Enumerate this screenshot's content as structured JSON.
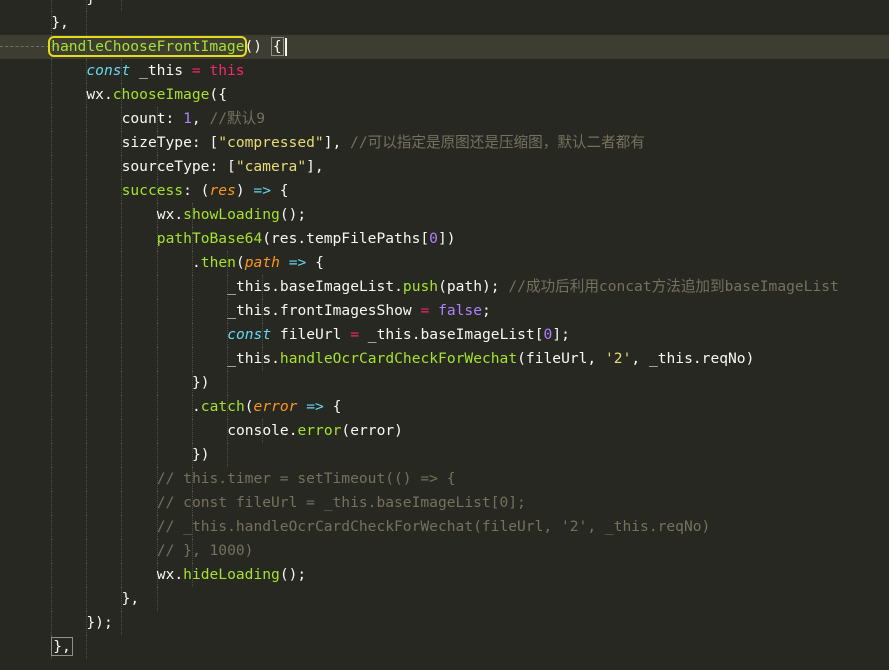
{
  "editor": {
    "lines": [
      {
        "tokens": [
          {
            "t": "}",
            "c": "plain"
          }
        ]
      },
      {
        "tokens": [
          {
            "t": "},",
            "c": "plain"
          }
        ]
      },
      {
        "tokens": [
          {
            "t": "handleChooseFrontImage",
            "c": "func",
            "hl": true
          },
          {
            "t": "() ",
            "c": "plain"
          },
          {
            "t": "{",
            "c": "plain",
            "bm": true
          }
        ],
        "current": true
      },
      {
        "tokens": [
          {
            "t": "const",
            "c": "storage"
          },
          {
            "t": " _this ",
            "c": "plain"
          },
          {
            "t": "=",
            "c": "kw"
          },
          {
            "t": " this",
            "c": "kw"
          }
        ]
      },
      {
        "tokens": [
          {
            "t": "wx.",
            "c": "plain"
          },
          {
            "t": "chooseImage",
            "c": "method"
          },
          {
            "t": "({",
            "c": "plain"
          }
        ]
      },
      {
        "tokens": [
          {
            "t": "count: ",
            "c": "plain"
          },
          {
            "t": "1",
            "c": "num"
          },
          {
            "t": ", ",
            "c": "plain"
          },
          {
            "t": "//默认9",
            "c": "comment"
          }
        ]
      },
      {
        "tokens": [
          {
            "t": "sizeType: [",
            "c": "plain"
          },
          {
            "t": "\"compressed\"",
            "c": "str"
          },
          {
            "t": "], ",
            "c": "plain"
          },
          {
            "t": "//可以指定是原图还是压缩图，默认二者都有",
            "c": "comment"
          }
        ]
      },
      {
        "tokens": [
          {
            "t": "sourceType: [",
            "c": "plain"
          },
          {
            "t": "\"camera\"",
            "c": "str"
          },
          {
            "t": "],",
            "c": "plain"
          }
        ]
      },
      {
        "tokens": [
          {
            "t": "success",
            "c": "func"
          },
          {
            "t": ": (",
            "c": "plain"
          },
          {
            "t": "res",
            "c": "param"
          },
          {
            "t": ") ",
            "c": "plain"
          },
          {
            "t": "=>",
            "c": "storage"
          },
          {
            "t": " {",
            "c": "plain"
          }
        ]
      },
      {
        "tokens": [
          {
            "t": "wx.",
            "c": "plain"
          },
          {
            "t": "showLoading",
            "c": "method"
          },
          {
            "t": "();",
            "c": "plain"
          }
        ]
      },
      {
        "tokens": [
          {
            "t": "pathToBase64",
            "c": "func"
          },
          {
            "t": "(res.tempFilePaths[",
            "c": "plain"
          },
          {
            "t": "0",
            "c": "num"
          },
          {
            "t": "])",
            "c": "plain"
          }
        ]
      },
      {
        "tokens": [
          {
            "t": ".",
            "c": "plain"
          },
          {
            "t": "then",
            "c": "method"
          },
          {
            "t": "(",
            "c": "plain"
          },
          {
            "t": "path",
            "c": "param"
          },
          {
            "t": " ",
            "c": "plain"
          },
          {
            "t": "=>",
            "c": "storage"
          },
          {
            "t": " {",
            "c": "plain"
          }
        ]
      },
      {
        "tokens": [
          {
            "t": "_this.baseImageList.",
            "c": "plain"
          },
          {
            "t": "push",
            "c": "method"
          },
          {
            "t": "(path); ",
            "c": "plain"
          },
          {
            "t": "//成功后利用concat方法追加到baseImageList",
            "c": "comment"
          }
        ]
      },
      {
        "tokens": [
          {
            "t": "_this.frontImagesShow ",
            "c": "plain"
          },
          {
            "t": "=",
            "c": "kw"
          },
          {
            "t": " ",
            "c": "plain"
          },
          {
            "t": "false",
            "c": "const"
          },
          {
            "t": ";",
            "c": "plain"
          }
        ]
      },
      {
        "tokens": [
          {
            "t": "const",
            "c": "storage"
          },
          {
            "t": " fileUrl ",
            "c": "plain"
          },
          {
            "t": "=",
            "c": "kw"
          },
          {
            "t": " _this.baseImageList[",
            "c": "plain"
          },
          {
            "t": "0",
            "c": "num"
          },
          {
            "t": "];",
            "c": "plain"
          }
        ]
      },
      {
        "tokens": [
          {
            "t": "_this.",
            "c": "plain"
          },
          {
            "t": "handleOcrCardCheckForWechat",
            "c": "method"
          },
          {
            "t": "(fileUrl, ",
            "c": "plain"
          },
          {
            "t": "'2'",
            "c": "str"
          },
          {
            "t": ", _this.reqNo)",
            "c": "plain"
          }
        ]
      },
      {
        "tokens": [
          {
            "t": "})",
            "c": "plain"
          }
        ]
      },
      {
        "tokens": [
          {
            "t": ".",
            "c": "plain"
          },
          {
            "t": "catch",
            "c": "method"
          },
          {
            "t": "(",
            "c": "plain"
          },
          {
            "t": "error",
            "c": "param"
          },
          {
            "t": " ",
            "c": "plain"
          },
          {
            "t": "=>",
            "c": "storage"
          },
          {
            "t": " {",
            "c": "plain"
          }
        ]
      },
      {
        "tokens": [
          {
            "t": "console.",
            "c": "plain"
          },
          {
            "t": "error",
            "c": "method"
          },
          {
            "t": "(error)",
            "c": "plain"
          }
        ]
      },
      {
        "tokens": [
          {
            "t": "})",
            "c": "plain"
          }
        ]
      },
      {
        "tokens": [
          {
            "t": "// this.timer = setTimeout(() => {",
            "c": "comment"
          }
        ]
      },
      {
        "tokens": [
          {
            "t": "// const fileUrl = _this.baseImageList[0];",
            "c": "comment"
          }
        ]
      },
      {
        "tokens": [
          {
            "t": "// _this.handleOcrCardCheckForWechat(fileUrl, '2', _this.reqNo)",
            "c": "comment"
          }
        ]
      },
      {
        "tokens": [
          {
            "t": "// }, 1000)",
            "c": "comment"
          }
        ]
      },
      {
        "tokens": [
          {
            "t": "wx.",
            "c": "plain"
          },
          {
            "t": "hideLoading",
            "c": "method"
          },
          {
            "t": "();",
            "c": "plain"
          }
        ]
      },
      {
        "tokens": [
          {
            "t": "},",
            "c": "plain"
          }
        ]
      },
      {
        "tokens": [
          {
            "t": "});",
            "c": "plain"
          }
        ]
      },
      {
        "tokens": [
          {
            "t": "},",
            "c": "plain",
            "bm": true
          }
        ]
      }
    ]
  },
  "colors": {
    "background": "#272822",
    "current_line": "#3e3d32",
    "find_highlight": "#e6db19",
    "keyword": "#f92672",
    "function": "#a6e22e",
    "string": "#e6db74",
    "number": "#ae81ff",
    "comment": "#75715e",
    "param": "#fd971f",
    "storage": "#66d9ef"
  }
}
